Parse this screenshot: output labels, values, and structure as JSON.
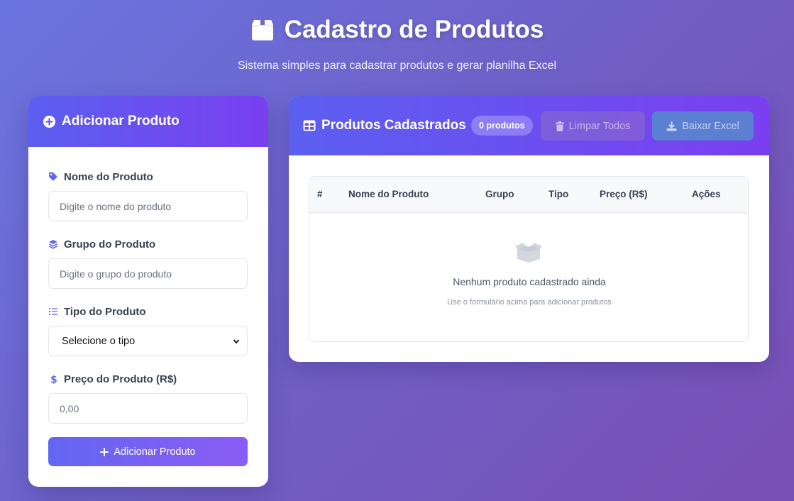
{
  "header": {
    "title": "Cadastro de Produtos",
    "subtitle": "Sistema simples para cadastrar produtos e gerar planilha Excel",
    "icon": "box-icon"
  },
  "form": {
    "title": "Adicionar Produto",
    "fields": {
      "name": {
        "label": "Nome do Produto",
        "placeholder": "Digite o nome do produto",
        "icon": "tag-icon"
      },
      "group": {
        "label": "Grupo do Produto",
        "placeholder": "Digite o grupo do produto",
        "icon": "layers-icon"
      },
      "type": {
        "label": "Tipo do Produto",
        "selected": "Selecione o tipo",
        "icon": "list-icon"
      },
      "price": {
        "label": "Preço do Produto (R$)",
        "placeholder": "0,00",
        "icon": "dollar-icon"
      }
    },
    "submit_label": "Adicionar Produto"
  },
  "list": {
    "title": "Produtos Cadastrados",
    "count_badge": "0 produtos",
    "clear_label": "Limpar Todos",
    "excel_label": "Baixar Excel",
    "columns": [
      "#",
      "Nome do Produto",
      "Grupo",
      "Tipo",
      "Preço (R$)",
      "Ações"
    ],
    "empty_title": "Nenhum produto cadastrado ainda",
    "empty_subtitle": "Use o formulário acima para adicionar produtos"
  },
  "colors": {
    "accent_start": "#5b5ff0",
    "accent_end": "#7a3ff0",
    "icon_accent": "#6366f1"
  }
}
